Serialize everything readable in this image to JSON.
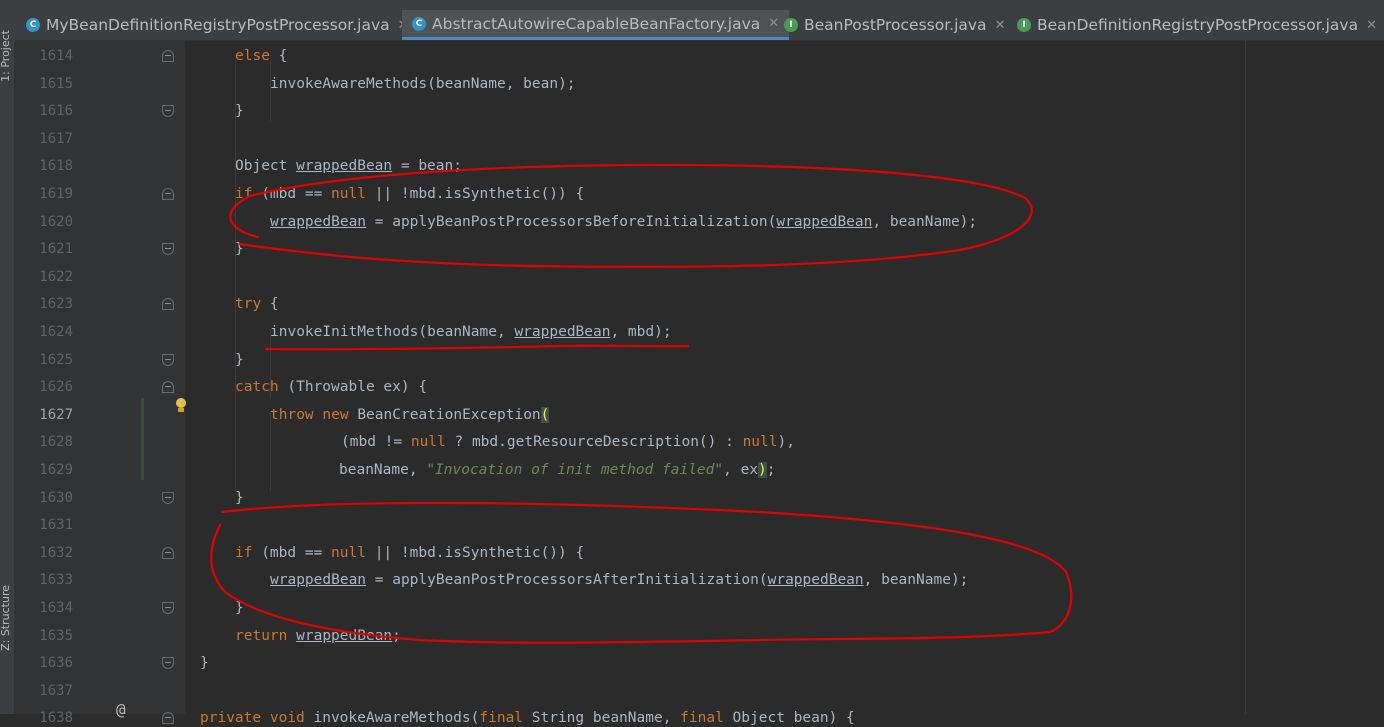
{
  "side_panel": {
    "project_label": "1: Project",
    "structure_label": "Z: Structure"
  },
  "tabs": [
    {
      "label": "MyBeanDefinitionRegistryPostProcessor.java",
      "icon": "class-icon",
      "icon_letter": "C",
      "icon_color": "#3592c4",
      "active": false,
      "closable": true
    },
    {
      "label": "AbstractAutowireCapableBeanFactory.java",
      "icon": "abstract-class-icon",
      "icon_letter": "C",
      "icon_color": "#3592c4",
      "active": true,
      "closable": true
    },
    {
      "label": "BeanPostProcessor.java",
      "icon": "interface-icon",
      "icon_letter": "I",
      "icon_color": "#499c54",
      "active": false,
      "closable": true
    },
    {
      "label": "BeanDefinitionRegistryPostProcessor.java",
      "icon": "interface-icon",
      "icon_letter": "I",
      "icon_color": "#499c54",
      "active": false,
      "closable": true
    }
  ],
  "editor": {
    "current_line": "1627",
    "line_numbers": [
      "1614",
      "1615",
      "1616",
      "1617",
      "1618",
      "1619",
      "1620",
      "1621",
      "1622",
      "1623",
      "1624",
      "1625",
      "1626",
      "1627",
      "1628",
      "1629",
      "1630",
      "1631",
      "1632",
      "1633",
      "1634",
      "1635",
      "1636",
      "1637",
      "1638"
    ],
    "lines": [
      [
        [
          "kw",
          "else"
        ],
        [
          "p",
          " {"
        ]
      ],
      [
        [
          "p",
          "invokeAwareMethods(beanName, bean);"
        ]
      ],
      [
        [
          "p",
          "}"
        ]
      ],
      [],
      [
        [
          "p",
          "Object "
        ],
        [
          "ul",
          "wrappedBean"
        ],
        [
          "p",
          " = bean;"
        ]
      ],
      [
        [
          "kw",
          "if"
        ],
        [
          "p",
          " (mbd == "
        ],
        [
          "kw",
          "null"
        ],
        [
          "p",
          " || !mbd.isSynthetic()) {"
        ]
      ],
      [
        [
          "ul",
          "wrappedBean"
        ],
        [
          "p",
          " = applyBeanPostProcessorsBeforeInitialization("
        ],
        [
          "ul",
          "wrappedBean"
        ],
        [
          "p",
          ", beanName);"
        ]
      ],
      [
        [
          "p",
          "}"
        ]
      ],
      [],
      [
        [
          "kw",
          "try"
        ],
        [
          "p",
          " {"
        ]
      ],
      [
        [
          "p",
          "invokeInitMethods(beanName, "
        ],
        [
          "ul",
          "wrappedBean"
        ],
        [
          "p",
          ", mbd);"
        ]
      ],
      [
        [
          "p",
          "}"
        ]
      ],
      [
        [
          "kw",
          "catch"
        ],
        [
          "p",
          " (Throwable ex) {"
        ]
      ],
      [
        [
          "kw",
          "throw"
        ],
        [
          "p",
          " "
        ],
        [
          "kw",
          "new"
        ],
        [
          "p",
          " BeanCreationException"
        ],
        [
          "paren",
          "("
        ]
      ],
      [
        [
          "p",
          "(mbd != "
        ],
        [
          "kw",
          "null"
        ],
        [
          "p",
          " ? mbd.getResourceDescription() : "
        ],
        [
          "kw",
          "null"
        ],
        [
          "p",
          "),"
        ]
      ],
      [
        [
          "p",
          "beanName, "
        ],
        [
          "str",
          "\"Invocation of init method failed\""
        ],
        [
          "p",
          ", ex"
        ],
        [
          "paren",
          ")"
        ],
        [
          "p",
          ";"
        ]
      ],
      [
        [
          "p",
          "}"
        ]
      ],
      [],
      [
        [
          "kw",
          "if"
        ],
        [
          "p",
          " (mbd == "
        ],
        [
          "kw",
          "null"
        ],
        [
          "p",
          " || !mbd.isSynthetic()) {"
        ]
      ],
      [
        [
          "ul",
          "wrappedBean"
        ],
        [
          "p",
          " = applyBeanPostProcessorsAfterInitialization("
        ],
        [
          "ul",
          "wrappedBean"
        ],
        [
          "p",
          ", beanName);"
        ]
      ],
      [
        [
          "p",
          "}"
        ]
      ],
      [
        [
          "kw",
          "return"
        ],
        [
          "p",
          " "
        ],
        [
          "ul",
          "wrappedBean"
        ],
        [
          "p",
          ";"
        ]
      ],
      [
        [
          "p",
          "}"
        ]
      ],
      [],
      [
        [
          "kw",
          "private void"
        ],
        [
          "p",
          " invokeAwareMethods("
        ],
        [
          "kw",
          "final"
        ],
        [
          "p",
          " String beanName, "
        ],
        [
          "kw",
          "final"
        ],
        [
          "p",
          " Object bean) {"
        ]
      ]
    ]
  },
  "colors": {
    "background": "#2b2b2b",
    "keyword": "#cc7832",
    "string": "#6a8759",
    "identifier": "#a9b7c6",
    "annotation_ink": "#e00000"
  }
}
